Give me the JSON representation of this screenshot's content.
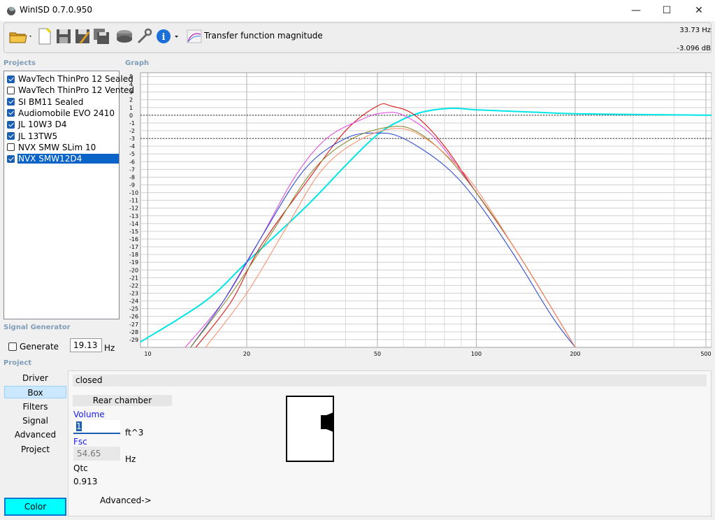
{
  "window": {
    "title": "WinISD 0.7.0.950",
    "minimize": "—",
    "maximize": "☐",
    "close": "✕"
  },
  "toolbar": {
    "transfer_label": "Transfer function magnitude",
    "readout_hz": "33.73 Hz",
    "readout_db": "-3.096 dB"
  },
  "sections": {
    "projects": "Projects",
    "graph": "Graph",
    "signal_generator": "Signal Generator",
    "project": "Project"
  },
  "projects": [
    {
      "name": "WavTech ThinPro 12 Sealed",
      "checked": true
    },
    {
      "name": "WavTech ThinPro 12 Vented",
      "checked": false
    },
    {
      "name": "SI BM11 Sealed",
      "checked": true
    },
    {
      "name": "Audiomobile EVO 2410",
      "checked": true
    },
    {
      "name": "JL 10W3 D4",
      "checked": true
    },
    {
      "name": "JL 13TW5",
      "checked": true
    },
    {
      "name": "NVX SMW SLim 10",
      "checked": false
    },
    {
      "name": "NVX SMW12D4",
      "checked": true,
      "selected": true
    }
  ],
  "signal": {
    "generate_label": "Generate",
    "freq_value": "19.13",
    "unit": "Hz"
  },
  "nav": [
    "Driver",
    "Box",
    "Filters",
    "Signal",
    "Advanced",
    "Project"
  ],
  "nav_active": "Box",
  "color_button": "Color",
  "box": {
    "type": "closed",
    "rear_chamber": "Rear chamber",
    "volume_label": "Volume",
    "volume_value": "1",
    "volume_unit": "ft^3",
    "fsc_label": "Fsc",
    "fsc_value": "54.65",
    "fsc_unit": "Hz",
    "qtc_label": "Qtc",
    "qtc_value": "0.913",
    "advanced": "Advanced->"
  },
  "chart_data": {
    "type": "line",
    "x_scale": "log",
    "xlim": [
      9.5,
      520
    ],
    "ylim": [
      -30,
      5.5
    ],
    "x_ticks": [
      10,
      20,
      50,
      100,
      200,
      500
    ],
    "y_ticks": [
      5,
      4,
      3,
      2,
      1,
      0,
      -1,
      -2,
      -3,
      -4,
      -5,
      -6,
      -7,
      -8,
      -9,
      -10,
      -11,
      -12,
      -13,
      -14,
      -15,
      -16,
      -17,
      -18,
      -19,
      -20,
      -21,
      -22,
      -23,
      -24,
      -25,
      -26,
      -27,
      -28,
      -29
    ],
    "reference_lines": [
      0,
      -3
    ],
    "grid": true,
    "series": [
      {
        "color": "#00e5e5",
        "points": [
          [
            9.5,
            -29.3
          ],
          [
            15,
            -24
          ],
          [
            20,
            -19
          ],
          [
            30,
            -12
          ],
          [
            40,
            -6.5
          ],
          [
            50,
            -2.5
          ],
          [
            60,
            -0.5
          ],
          [
            70,
            0.5
          ],
          [
            85,
            0.9
          ],
          [
            100,
            0.7
          ],
          [
            150,
            0.4
          ],
          [
            200,
            0.2
          ],
          [
            300,
            0.1
          ],
          [
            520,
            0
          ]
        ]
      },
      {
        "color": "#e00000",
        "points": [
          [
            14,
            -30
          ],
          [
            18,
            -24
          ],
          [
            22,
            -17
          ],
          [
            30,
            -9
          ],
          [
            40,
            -2
          ],
          [
            50,
            1.2
          ],
          [
            55,
            1.2
          ],
          [
            65,
            0
          ],
          [
            80,
            -4
          ],
          [
            100,
            -10
          ],
          [
            130,
            -17
          ],
          [
            170,
            -25
          ],
          [
            200,
            -30
          ]
        ]
      },
      {
        "color": "#e040e0",
        "points": [
          [
            13,
            -30
          ],
          [
            17,
            -24
          ],
          [
            22,
            -16
          ],
          [
            28,
            -8
          ],
          [
            35,
            -3
          ],
          [
            45,
            -0.5
          ],
          [
            52,
            0.3
          ],
          [
            60,
            0
          ],
          [
            75,
            -3
          ],
          [
            100,
            -10
          ],
          [
            130,
            -17
          ],
          [
            170,
            -25
          ],
          [
            200,
            -30
          ]
        ]
      },
      {
        "color": "#2040d0",
        "points": [
          [
            13.5,
            -30
          ],
          [
            17,
            -24
          ],
          [
            22,
            -16
          ],
          [
            30,
            -7
          ],
          [
            40,
            -3
          ],
          [
            50,
            -2.3
          ],
          [
            60,
            -3
          ],
          [
            80,
            -6.5
          ],
          [
            100,
            -11
          ],
          [
            130,
            -18
          ],
          [
            170,
            -26
          ],
          [
            200,
            -30
          ]
        ]
      },
      {
        "color": "#808020",
        "points": [
          [
            13.5,
            -30
          ],
          [
            18,
            -23
          ],
          [
            24,
            -15
          ],
          [
            32,
            -7
          ],
          [
            42,
            -3
          ],
          [
            55,
            -1.5
          ],
          [
            65,
            -2
          ],
          [
            80,
            -5
          ],
          [
            100,
            -10
          ],
          [
            130,
            -17
          ],
          [
            170,
            -25
          ],
          [
            200,
            -30
          ]
        ]
      },
      {
        "color": "#ff8860",
        "points": [
          [
            15,
            -30
          ],
          [
            20,
            -23
          ],
          [
            26,
            -15
          ],
          [
            34,
            -7
          ],
          [
            45,
            -3
          ],
          [
            58,
            -1.7
          ],
          [
            70,
            -3
          ],
          [
            85,
            -6
          ],
          [
            100,
            -9.5
          ],
          [
            130,
            -17
          ],
          [
            170,
            -25
          ],
          [
            200,
            -30
          ]
        ]
      }
    ]
  }
}
